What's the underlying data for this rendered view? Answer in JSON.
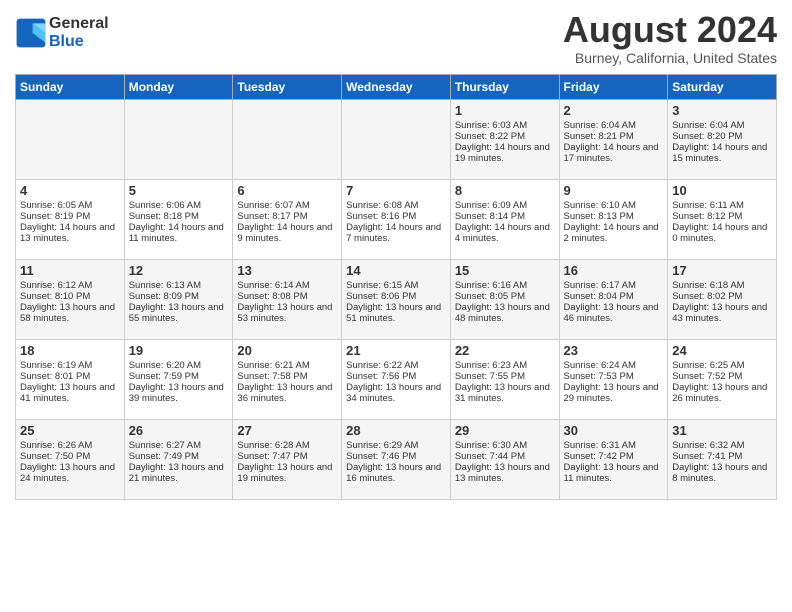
{
  "header": {
    "logo_line1": "General",
    "logo_line2": "Blue",
    "month": "August 2024",
    "location": "Burney, California, United States"
  },
  "days_of_week": [
    "Sunday",
    "Monday",
    "Tuesday",
    "Wednesday",
    "Thursday",
    "Friday",
    "Saturday"
  ],
  "weeks": [
    [
      {
        "day": "",
        "sunrise": "",
        "sunset": "",
        "daylight": ""
      },
      {
        "day": "",
        "sunrise": "",
        "sunset": "",
        "daylight": ""
      },
      {
        "day": "",
        "sunrise": "",
        "sunset": "",
        "daylight": ""
      },
      {
        "day": "",
        "sunrise": "",
        "sunset": "",
        "daylight": ""
      },
      {
        "day": "1",
        "sunrise": "6:03 AM",
        "sunset": "8:22 PM",
        "daylight": "14 hours and 19 minutes."
      },
      {
        "day": "2",
        "sunrise": "6:04 AM",
        "sunset": "8:21 PM",
        "daylight": "14 hours and 17 minutes."
      },
      {
        "day": "3",
        "sunrise": "6:04 AM",
        "sunset": "8:20 PM",
        "daylight": "14 hours and 15 minutes."
      }
    ],
    [
      {
        "day": "4",
        "sunrise": "6:05 AM",
        "sunset": "8:19 PM",
        "daylight": "14 hours and 13 minutes."
      },
      {
        "day": "5",
        "sunrise": "6:06 AM",
        "sunset": "8:18 PM",
        "daylight": "14 hours and 11 minutes."
      },
      {
        "day": "6",
        "sunrise": "6:07 AM",
        "sunset": "8:17 PM",
        "daylight": "14 hours and 9 minutes."
      },
      {
        "day": "7",
        "sunrise": "6:08 AM",
        "sunset": "8:16 PM",
        "daylight": "14 hours and 7 minutes."
      },
      {
        "day": "8",
        "sunrise": "6:09 AM",
        "sunset": "8:14 PM",
        "daylight": "14 hours and 4 minutes."
      },
      {
        "day": "9",
        "sunrise": "6:10 AM",
        "sunset": "8:13 PM",
        "daylight": "14 hours and 2 minutes."
      },
      {
        "day": "10",
        "sunrise": "6:11 AM",
        "sunset": "8:12 PM",
        "daylight": "14 hours and 0 minutes."
      }
    ],
    [
      {
        "day": "11",
        "sunrise": "6:12 AM",
        "sunset": "8:10 PM",
        "daylight": "13 hours and 58 minutes."
      },
      {
        "day": "12",
        "sunrise": "6:13 AM",
        "sunset": "8:09 PM",
        "daylight": "13 hours and 55 minutes."
      },
      {
        "day": "13",
        "sunrise": "6:14 AM",
        "sunset": "8:08 PM",
        "daylight": "13 hours and 53 minutes."
      },
      {
        "day": "14",
        "sunrise": "6:15 AM",
        "sunset": "8:06 PM",
        "daylight": "13 hours and 51 minutes."
      },
      {
        "day": "15",
        "sunrise": "6:16 AM",
        "sunset": "8:05 PM",
        "daylight": "13 hours and 48 minutes."
      },
      {
        "day": "16",
        "sunrise": "6:17 AM",
        "sunset": "8:04 PM",
        "daylight": "13 hours and 46 minutes."
      },
      {
        "day": "17",
        "sunrise": "6:18 AM",
        "sunset": "8:02 PM",
        "daylight": "13 hours and 43 minutes."
      }
    ],
    [
      {
        "day": "18",
        "sunrise": "6:19 AM",
        "sunset": "8:01 PM",
        "daylight": "13 hours and 41 minutes."
      },
      {
        "day": "19",
        "sunrise": "6:20 AM",
        "sunset": "7:59 PM",
        "daylight": "13 hours and 39 minutes."
      },
      {
        "day": "20",
        "sunrise": "6:21 AM",
        "sunset": "7:58 PM",
        "daylight": "13 hours and 36 minutes."
      },
      {
        "day": "21",
        "sunrise": "6:22 AM",
        "sunset": "7:56 PM",
        "daylight": "13 hours and 34 minutes."
      },
      {
        "day": "22",
        "sunrise": "6:23 AM",
        "sunset": "7:55 PM",
        "daylight": "13 hours and 31 minutes."
      },
      {
        "day": "23",
        "sunrise": "6:24 AM",
        "sunset": "7:53 PM",
        "daylight": "13 hours and 29 minutes."
      },
      {
        "day": "24",
        "sunrise": "6:25 AM",
        "sunset": "7:52 PM",
        "daylight": "13 hours and 26 minutes."
      }
    ],
    [
      {
        "day": "25",
        "sunrise": "6:26 AM",
        "sunset": "7:50 PM",
        "daylight": "13 hours and 24 minutes."
      },
      {
        "day": "26",
        "sunrise": "6:27 AM",
        "sunset": "7:49 PM",
        "daylight": "13 hours and 21 minutes."
      },
      {
        "day": "27",
        "sunrise": "6:28 AM",
        "sunset": "7:47 PM",
        "daylight": "13 hours and 19 minutes."
      },
      {
        "day": "28",
        "sunrise": "6:29 AM",
        "sunset": "7:46 PM",
        "daylight": "13 hours and 16 minutes."
      },
      {
        "day": "29",
        "sunrise": "6:30 AM",
        "sunset": "7:44 PM",
        "daylight": "13 hours and 13 minutes."
      },
      {
        "day": "30",
        "sunrise": "6:31 AM",
        "sunset": "7:42 PM",
        "daylight": "13 hours and 11 minutes."
      },
      {
        "day": "31",
        "sunrise": "6:32 AM",
        "sunset": "7:41 PM",
        "daylight": "13 hours and 8 minutes."
      }
    ]
  ],
  "labels": {
    "sunrise_prefix": "Sunrise: ",
    "sunset_prefix": "Sunset: ",
    "daylight_prefix": "Daylight: "
  }
}
